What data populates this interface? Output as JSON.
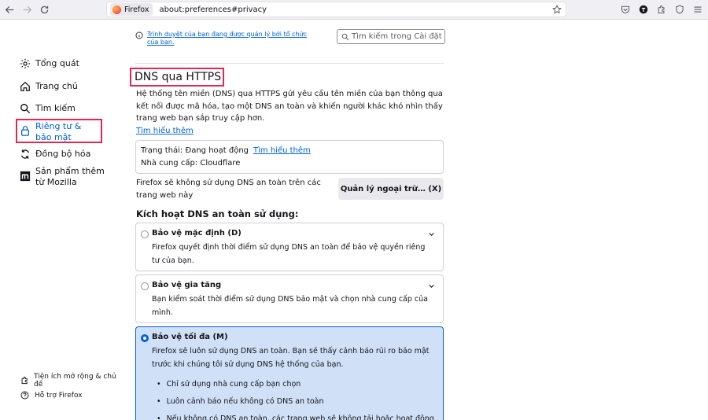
{
  "browser": {
    "identity_label": "Firefox",
    "url": "about:preferences#privacy"
  },
  "sidebar": {
    "items": [
      {
        "label": "Tổng quát",
        "icon": "gear-icon"
      },
      {
        "label": "Trang chủ",
        "icon": "home-icon"
      },
      {
        "label": "Tìm kiếm",
        "icon": "search-icon"
      },
      {
        "label": "Riêng tư & bảo mật",
        "icon": "lock-icon",
        "selected": true
      },
      {
        "label": "Đồng bộ hóa",
        "icon": "sync-icon"
      },
      {
        "label": "Sản phẩm thêm từ Mozilla",
        "icon": "mozilla-icon"
      }
    ],
    "footer": [
      {
        "label": "Tiện ích mở rộng & chủ đề",
        "icon": "puzzle-icon"
      },
      {
        "label": "Hỗ trợ Firefox",
        "icon": "help-icon"
      }
    ]
  },
  "main": {
    "policy_notice": "Trình duyệt của bạn đang được quản lý bởi tổ chức của bạn.",
    "search_placeholder": "Tìm kiếm trong Cài đặt",
    "section_title": "DNS qua HTTPS",
    "description": "Hệ thống tên miền (DNS) qua HTTPS gửi yêu cầu tên miền của bạn thông qua kết nối được mã hóa, tạo một DNS an toàn và khiến người khác khó nhìn thấy trang web bạn sắp truy cập hơn.",
    "learn_more": "Tìm hiểu thêm",
    "status_label": "Trạng thái: Đang hoạt động",
    "status_learn_more": "Tìm hiểu thêm",
    "provider_label": "Nhà cung cấp: Cloudflare",
    "exceptions_text": "Firefox sẽ không sử dụng DNS an toàn trên các trang web này",
    "exceptions_button": "Quản lý ngoại trừ… (X)",
    "enable_heading": "Kích hoạt DNS an toàn sử dụng:",
    "options": [
      {
        "title": "Bảo vệ mặc định (D)",
        "desc": "Firefox quyết định thời điểm sử dụng DNS an toàn để bảo vệ quyền riêng tư của bạn."
      },
      {
        "title": "Bảo vệ gia tăng",
        "desc": "Bạn kiểm soát thời điểm sử dụng DNS bảo mật và chọn nhà cung cấp của mình."
      },
      {
        "title": "Bảo vệ tối đa (M)",
        "desc": "Firefox sẽ luôn sử dụng DNS an toàn. Bạn sẽ thấy cảnh báo rủi ro bảo mật trước khi chúng tôi sử dụng DNS hệ thống của bạn.",
        "bullets": [
          "Chỉ sử dụng nhà cung cấp bạn chọn",
          "Luôn cảnh báo nếu không có DNS an toàn",
          "Nếu không có DNS an toàn, các trang web sẽ không tải hoặc hoạt động"
        ]
      }
    ]
  }
}
